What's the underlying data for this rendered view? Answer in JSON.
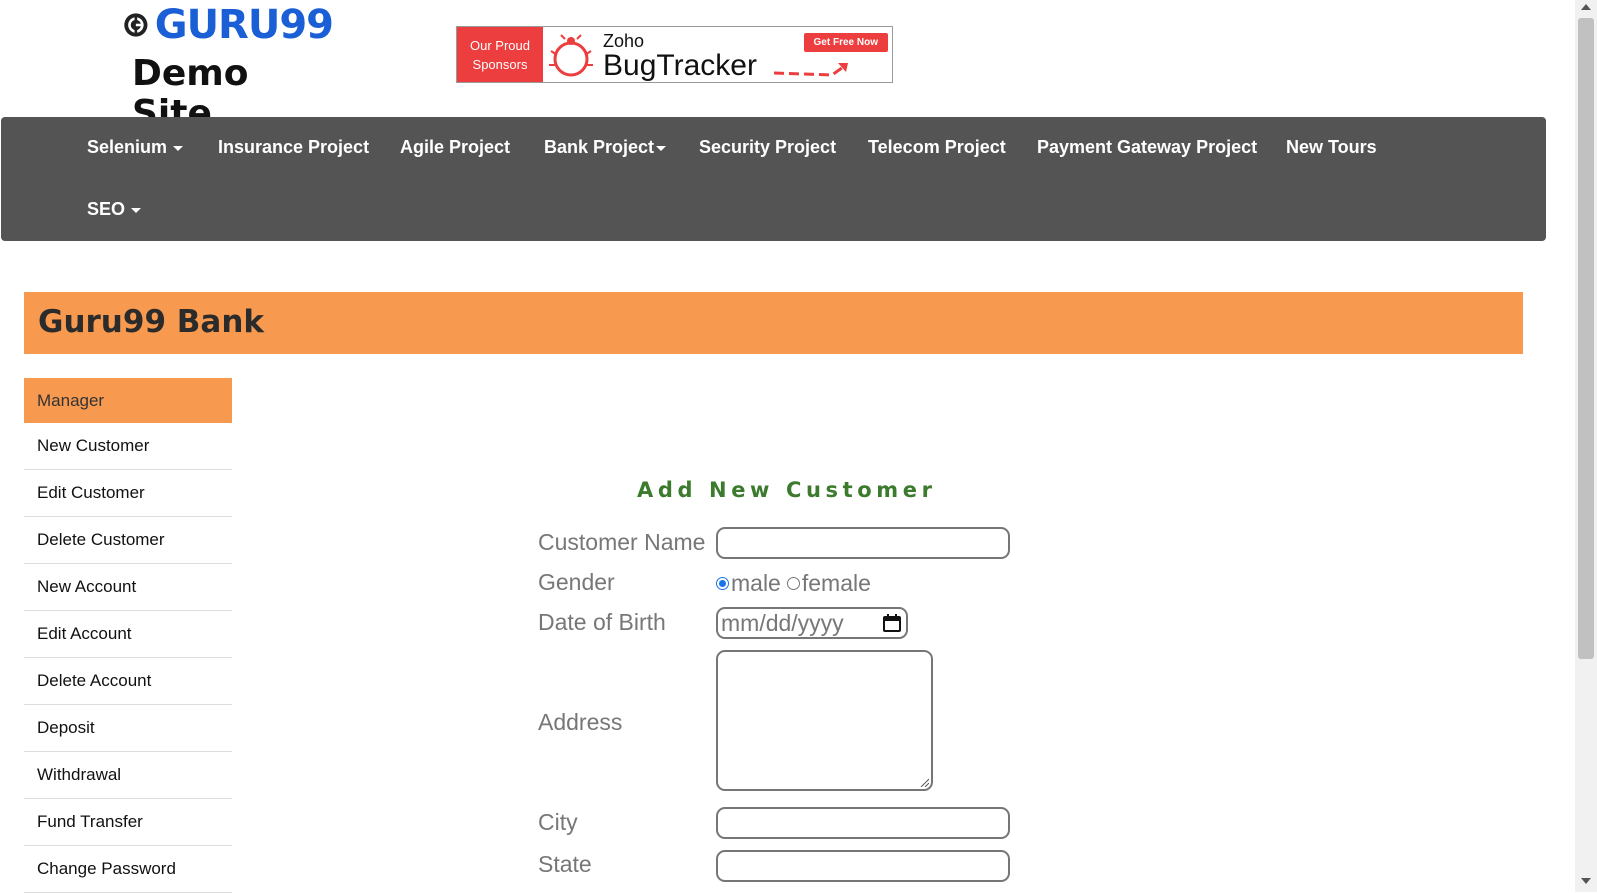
{
  "header": {
    "logo_text": "GURU99",
    "logo_subtitle": "Demo Site",
    "ad": {
      "left_line1": "Our Proud",
      "left_line2": "Sponsors",
      "brand_top": "Zoho",
      "brand_main": "BugTracker",
      "cta": "Get Free Now"
    }
  },
  "nav": {
    "items": [
      {
        "label": "Selenium",
        "dropdown": true
      },
      {
        "label": "Insurance Project",
        "dropdown": false
      },
      {
        "label": "Agile Project",
        "dropdown": false
      },
      {
        "label": "Bank Project",
        "dropdown": true
      },
      {
        "label": "Security Project",
        "dropdown": false
      },
      {
        "label": "Telecom Project",
        "dropdown": false
      },
      {
        "label": "Payment Gateway Project",
        "dropdown": false
      },
      {
        "label": "New Tours",
        "dropdown": false
      },
      {
        "label": "SEO",
        "dropdown": true
      }
    ]
  },
  "banner": {
    "title": "Guru99 Bank"
  },
  "sidebar": {
    "header": "Manager",
    "items": [
      {
        "label": "New Customer"
      },
      {
        "label": "Edit Customer"
      },
      {
        "label": "Delete Customer"
      },
      {
        "label": "New Account"
      },
      {
        "label": "Edit Account"
      },
      {
        "label": "Delete Account"
      },
      {
        "label": "Deposit"
      },
      {
        "label": "Withdrawal"
      },
      {
        "label": "Fund Transfer"
      },
      {
        "label": "Change Password"
      }
    ]
  },
  "form": {
    "title": "Add New Customer",
    "labels": {
      "customer_name": "Customer Name",
      "gender": "Gender",
      "dob": "Date of Birth",
      "address": "Address",
      "city": "City",
      "state": "State"
    },
    "gender_options": {
      "male": "male",
      "female": "female",
      "selected": "male"
    },
    "dob_placeholder": "mm/dd/yyyy",
    "customer_name_value": "",
    "city_value": "",
    "state_value": ""
  },
  "colors": {
    "navbar": "#545454",
    "accent_orange": "#f79a50",
    "title_green": "#3c7a2d",
    "logo_blue": "#1a5fd6",
    "ad_red": "#ec3e3e"
  }
}
